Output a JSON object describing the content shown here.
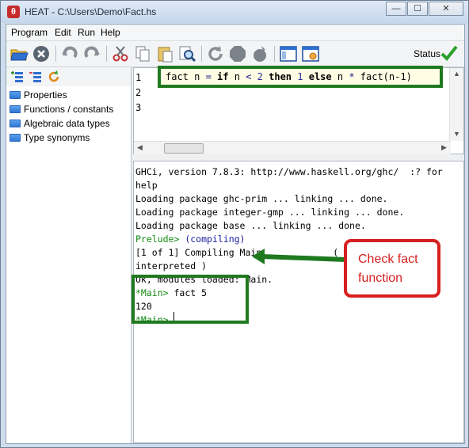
{
  "window": {
    "title": "HEAT - C:\\Users\\Demo\\Fact.hs",
    "app_icon_glyph": "θ",
    "buttons": {
      "minimize": "—",
      "maximize": "☐",
      "close": "✕"
    }
  },
  "menu": [
    "Program",
    "Edit",
    "Run",
    "Help"
  ],
  "toolbar": {
    "icons": [
      "open-folder-icon",
      "stop-icon",
      "undo-icon",
      "redo-icon",
      "cut-icon",
      "copy-icon",
      "paste-icon",
      "find-icon",
      "refresh-icon",
      "stop-octagon-icon",
      "compile-icon",
      "panel-icon",
      "settings-panel-icon"
    ],
    "status_label": "Status"
  },
  "left_pane": {
    "tools": [
      "add-tree-icon",
      "tree-list-icon",
      "refresh-tree-icon"
    ],
    "items": [
      "Properties",
      "Functions / constants",
      "Algebraic data types",
      "Type synonyms"
    ]
  },
  "editor": {
    "line_numbers": [
      "1",
      "2",
      "3"
    ],
    "code": {
      "t1": "fact n ",
      "op1": "=",
      "t2": " ",
      "kw_if": "if",
      "t3": " n ",
      "op2": "<",
      "t4": " ",
      "n1": "2",
      "t5": " ",
      "kw_then": "then",
      "t6": " ",
      "n2": "1",
      "t7": " ",
      "kw_else": "else",
      "t8": " n ",
      "op3": "*",
      "t9": " fact(n-1)"
    }
  },
  "console": {
    "lines": [
      {
        "text": "GHCi, version 7.8.3: http://www.haskell.org/ghc/  :? for",
        "style": "plain"
      },
      {
        "text": "help",
        "style": "plain"
      },
      {
        "text": "Loading package ghc-prim ... linking ... done.",
        "style": "plain"
      },
      {
        "text": "Loading package integer-gmp ... linking ... done.",
        "style": "plain"
      },
      {
        "text": "Loading package base ... linking ... done.",
        "style": "plain"
      },
      {
        "prompt": "Prelude>",
        "rest": " (compiling)",
        "style": "prompt"
      },
      {
        "text": "[1 of 1] Compiling Main             ( Fact.hs,",
        "style": "plain"
      },
      {
        "text": "interpreted )",
        "style": "plain"
      },
      {
        "text": "Ok, modules loaded: Main.",
        "style": "plain"
      },
      {
        "prompt": "*Main>",
        "rest": " fact 5",
        "style": "prompt"
      },
      {
        "text": "120",
        "style": "plain"
      },
      {
        "prompt": "*Main>",
        "rest": "",
        "style": "prompt"
      }
    ]
  },
  "callout": {
    "line1": "Check fact",
    "line2": "function"
  },
  "colors": {
    "highlight_box": "#1f7a1f",
    "callout": "#d81f1f",
    "prompt": "#138a13"
  }
}
